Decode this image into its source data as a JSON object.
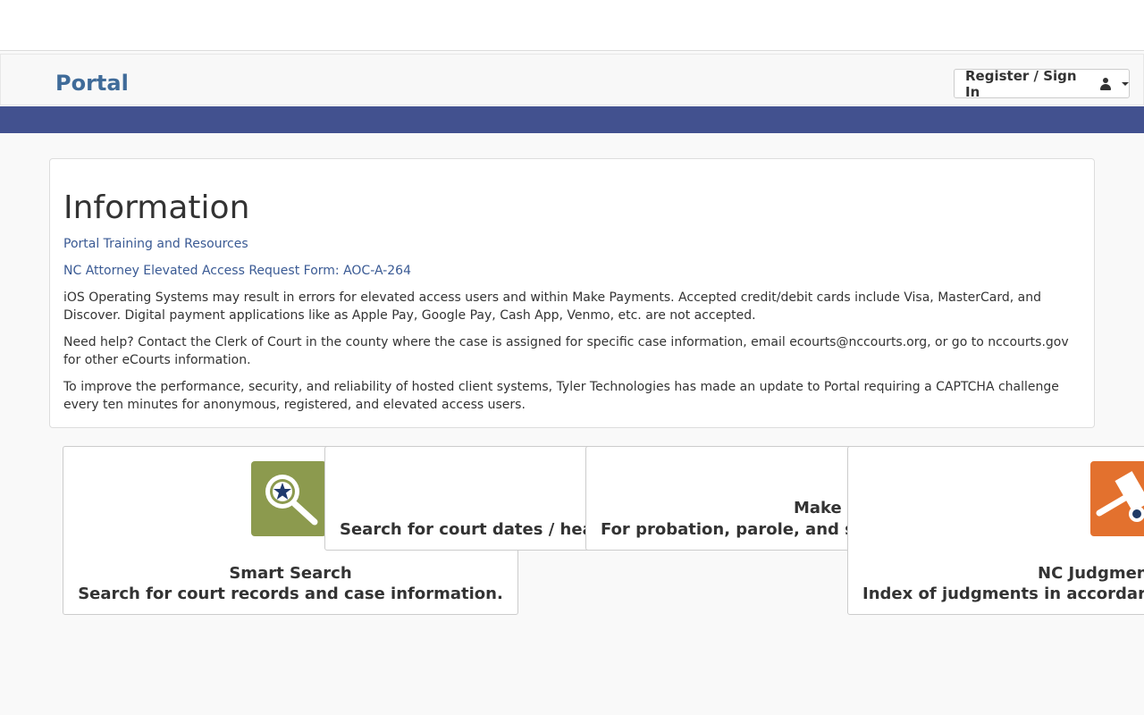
{
  "header": {
    "brand": "Portal",
    "signin_label": "Register / Sign In"
  },
  "info": {
    "title": "Information",
    "link1": "Portal Training and Resources",
    "link2": "NC Attorney Elevated Access Request Form: AOC-A-264",
    "para1": "iOS Operating Systems may result in errors for elevated access users and within Make Payments. Accepted credit/debit cards include Visa, MasterCard, and Discover. Digital payment applications like as Apple Pay, Google Pay, Cash App, Venmo, etc. are not accepted.",
    "para2": "Need help? Contact the Clerk of Court in the county where the case is assigned for specific case information, email ecourts@nccourts.org, or go to nccourts.gov for other eCourts information.",
    "para3": "To improve the performance, security, and reliability of hosted client systems, Tyler Technologies has made an update to Portal requiring a CAPTCHA challenge every ten minutes for anonymous, registered, and elevated access users."
  },
  "tiles": {
    "smart_search": {
      "title": "Smart Search",
      "desc": "Search for court records and case information."
    },
    "hearings": {
      "desc": "Search for court dates / hea"
    },
    "payments": {
      "title": "Make",
      "desc": "For probation, parole, and s"
    },
    "judgments": {
      "title": "NC Judgmen",
      "desc": "Index of judgments in accordar"
    }
  },
  "colors": {
    "nav_bar": "#42518f",
    "brand": "#3f6b99",
    "smart_search_icon": "#8c9a4e",
    "judgment_icon": "#e3712e"
  },
  "icons": {
    "signin": "user-icon",
    "smart_search": "magnifier-star-icon",
    "judgments": "gavel-icon"
  }
}
